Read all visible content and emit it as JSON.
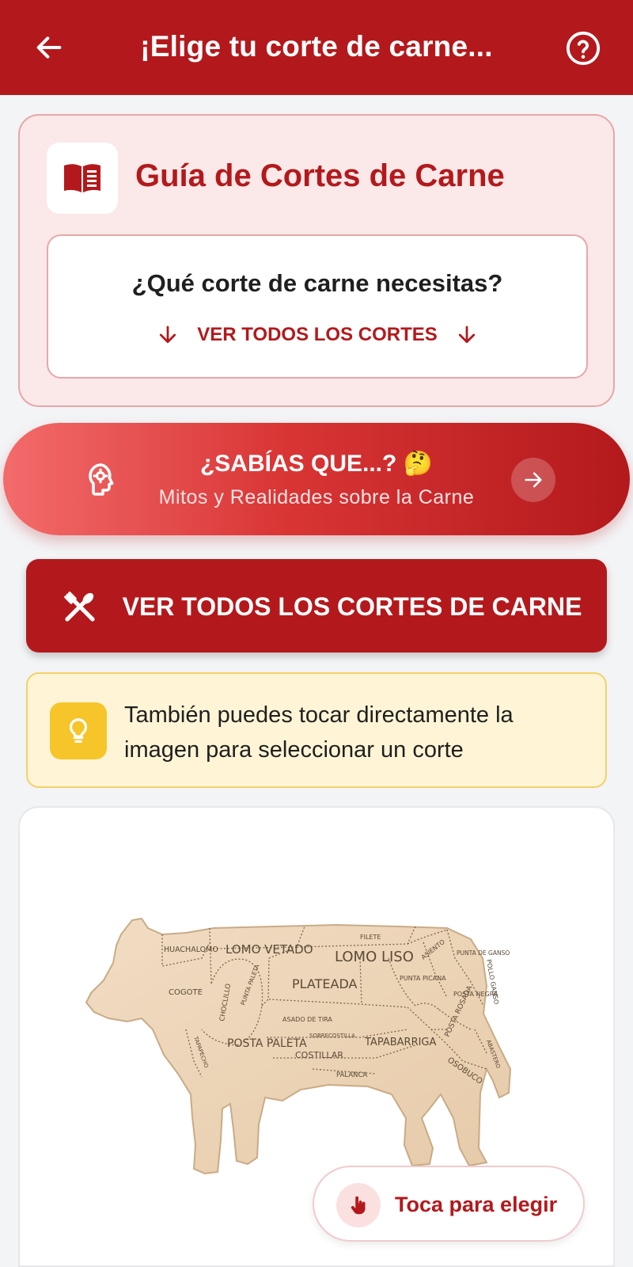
{
  "appbar": {
    "title": "¡Elige tu corte de carne...",
    "back_icon": "arrow-left-icon",
    "help_icon": "help-circle-icon"
  },
  "guide": {
    "title": "Guía de Cortes de Carne",
    "icon": "book-icon",
    "question": "¿Qué corte de carne necesitas?",
    "link_label": "VER TODOS LOS CORTES"
  },
  "did_you_know": {
    "title": "¿SABÍAS QUE...? 🤔",
    "subtitle": "Mitos y Realidades sobre la Carne",
    "icon": "brain-gear-icon",
    "arrow_icon": "arrow-right-icon"
  },
  "all_cuts_button": {
    "label": "VER TODOS LOS CORTES DE CARNE",
    "icon": "utensils-crossed-icon"
  },
  "tip": {
    "text": "También puedes tocar directamente la imagen para seleccionar un corte",
    "icon": "lightbulb-icon"
  },
  "cow_image": {
    "cuts": [
      "HUACHALOMO",
      "LOMO VETADO",
      "FILETE",
      "LOMO LISO",
      "ASIENTO",
      "PUNTA DE GANSO",
      "POLLO GANSO",
      "COGOTE",
      "CHOCLILLO",
      "PUNTA PALETA",
      "PLATEADA",
      "PUNTA PICANA",
      "POSTA NEGRA",
      "POSTA ROSADA",
      "POSTA PALETA",
      "ASADO DE TIRA",
      "SOBRECOSTILLA",
      "TAPAPECHO",
      "COSTILLAR",
      "TAPABARRIGA",
      "PALANCA",
      "OSOBUCO",
      "ABASTERO"
    ]
  },
  "touch_pill": {
    "label": "Toca para elegir",
    "icon": "hand-pointer-icon"
  },
  "colors": {
    "primary": "#b3191c",
    "card_bg": "#fbe8e8",
    "tip_bg": "#fff5d6",
    "tip_icon_bg": "#f6c52a"
  }
}
